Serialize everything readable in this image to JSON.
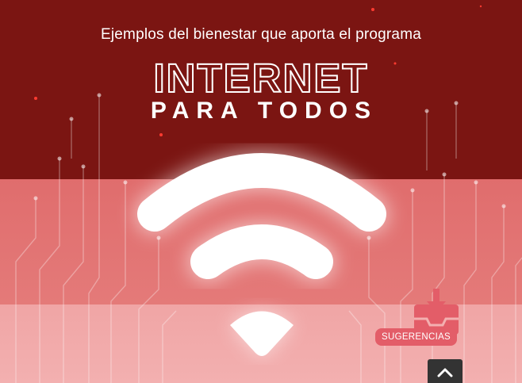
{
  "banner": {
    "subtitle": "Ejemplos del bienestar que aporta el programa",
    "logo_line1": "INTERNET",
    "logo_line2": "PARA TODOS",
    "icon": "wifi-icon"
  },
  "suggestions_widget": {
    "icon": "inbox-download-icon",
    "label": "SUGERENCIAS"
  },
  "back_to_top": {
    "icon": "chevron-up-icon"
  },
  "colors": {
    "dark_red": "#7b1512",
    "mid_red": "#e06d6d",
    "light_red": "#f0a5a5",
    "accent_pink": "#e35d68",
    "back_to_top_bg": "#333333"
  }
}
